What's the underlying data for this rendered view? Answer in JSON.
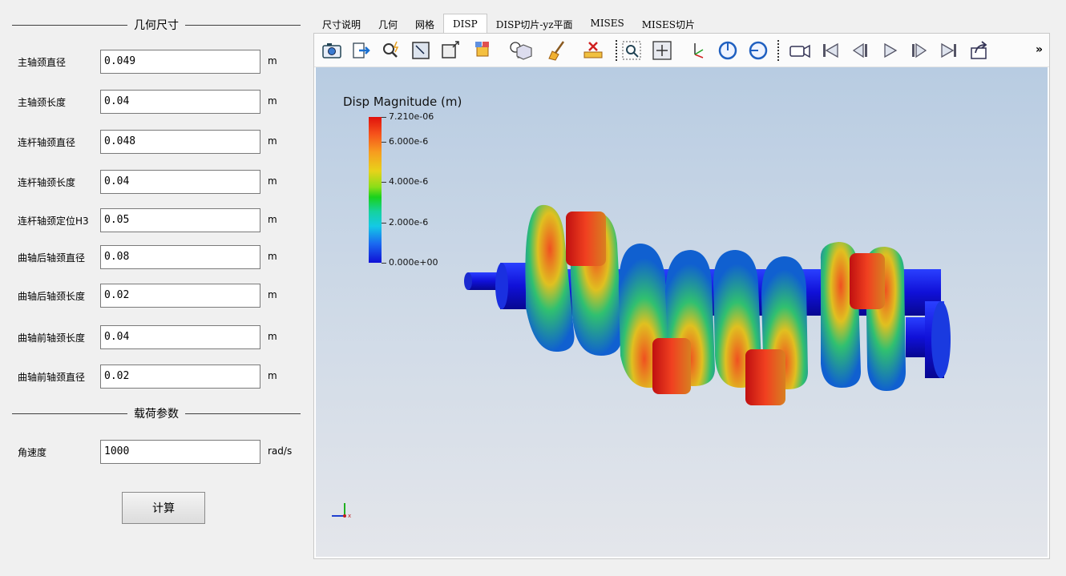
{
  "geometry_group": {
    "title": "几何尺寸"
  },
  "load_group": {
    "title": "载荷参数"
  },
  "params": [
    {
      "label": "主轴颈直径",
      "value": "0.049",
      "unit": "m"
    },
    {
      "label": "主轴颈长度",
      "value": "0.04",
      "unit": "m"
    },
    {
      "label": "连杆轴颈直径",
      "value": "0.048",
      "unit": "m"
    },
    {
      "label": "连杆轴颈长度",
      "value": "0.04",
      "unit": "m"
    },
    {
      "label": "连杆轴颈定位H3",
      "value": "0.05",
      "unit": "m"
    },
    {
      "label": "曲轴后轴颈直径",
      "value": "0.08",
      "unit": "m"
    },
    {
      "label": "曲轴后轴颈长度",
      "value": "0.02",
      "unit": "m"
    },
    {
      "label": "曲轴前轴颈长度",
      "value": "0.04",
      "unit": "m"
    },
    {
      "label": "曲轴前轴颈直径",
      "value": "0.02",
      "unit": "m"
    }
  ],
  "load_params": [
    {
      "label": "角速度",
      "value": "1000",
      "unit": "rad/s"
    }
  ],
  "calc_button": "计算",
  "tabs": [
    {
      "label": "尺寸说明",
      "active": false
    },
    {
      "label": "几何",
      "active": false
    },
    {
      "label": "网格",
      "active": false
    },
    {
      "label": "DISP",
      "active": true
    },
    {
      "label": "DISP切片-yz平面",
      "active": false
    },
    {
      "label": "MISES",
      "active": false
    },
    {
      "label": "MISES切片",
      "active": false
    }
  ],
  "toolbar": {
    "icons": [
      "camera-icon",
      "export-icon",
      "magic-search-icon",
      "reset-view-icon",
      "zoom-extents-icon",
      "representation-icon",
      "light-icon",
      "box-view-icon",
      "clear-icon",
      "ruler-icon",
      "zoom-box-icon",
      "fit-all-icon",
      "axes-orient-icon",
      "rotate-cw-icon",
      "rotate-ccw-icon",
      "video-camera-icon",
      "first-frame-icon",
      "prev-frame-icon",
      "play-icon",
      "next-frame-icon",
      "last-frame-icon",
      "share-icon"
    ],
    "more": "»"
  },
  "legend": {
    "title": "Disp Magnitude (m)",
    "labels": [
      "7.210e-06",
      "6.000e-6",
      "4.000e-6",
      "2.000e-6",
      "0.000e+00"
    ],
    "fractions": [
      1.0,
      0.832,
      0.555,
      0.277,
      0.0
    ]
  },
  "colors": {
    "accent": "#1010d6",
    "max": "#e0110c",
    "background_top": "#b8cce2",
    "background_bottom": "#e4e6eb"
  }
}
